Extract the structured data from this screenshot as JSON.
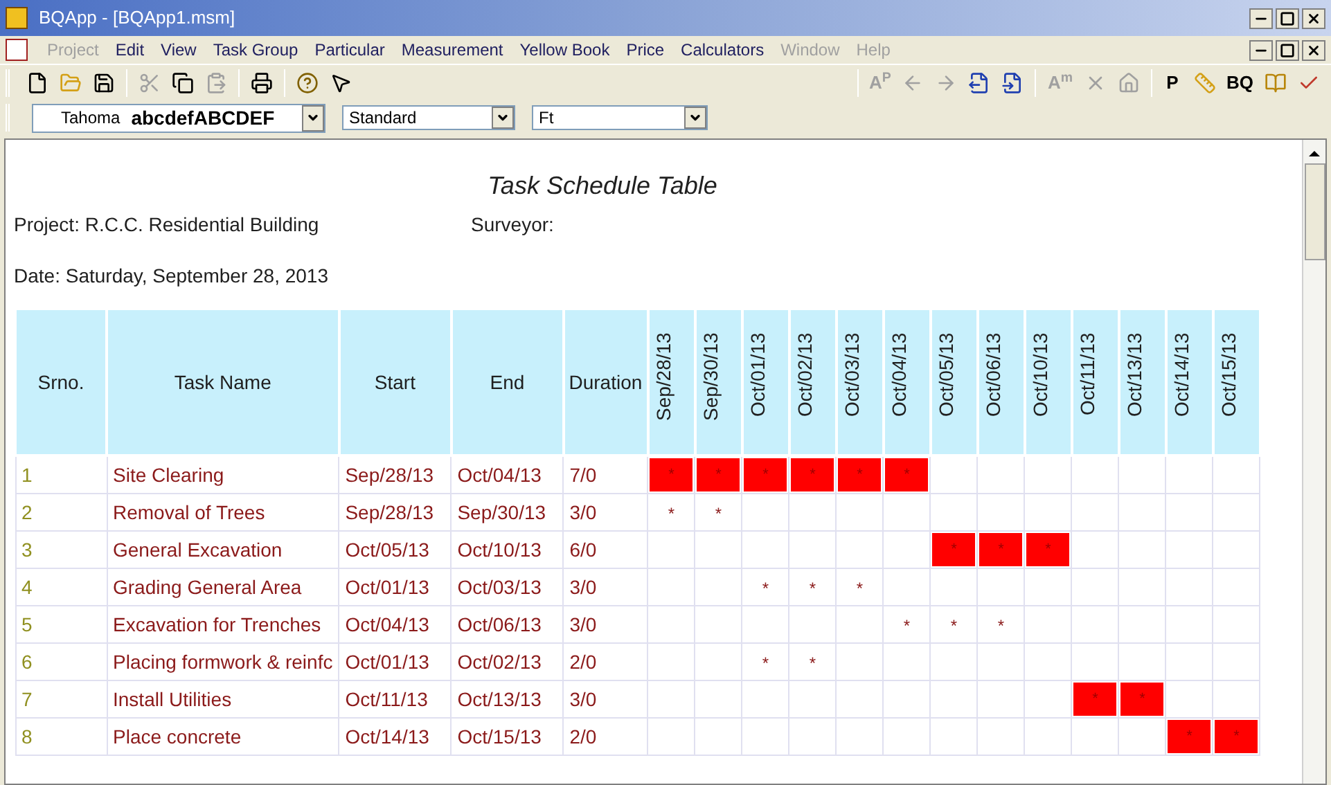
{
  "window": {
    "title": "BQApp - [BQApp1.msm]"
  },
  "menu": [
    {
      "label": "Project",
      "disabled": true
    },
    {
      "label": "Edit",
      "disabled": false
    },
    {
      "label": "View",
      "disabled": false
    },
    {
      "label": "Task Group",
      "disabled": false
    },
    {
      "label": "Particular",
      "disabled": false
    },
    {
      "label": "Measurement",
      "disabled": false
    },
    {
      "label": "Yellow Book",
      "disabled": false
    },
    {
      "label": "Price",
      "disabled": false
    },
    {
      "label": "Calculators",
      "disabled": false
    },
    {
      "label": "Window",
      "disabled": true
    },
    {
      "label": "Help",
      "disabled": true
    }
  ],
  "toolbar_left": [
    {
      "kind": "new",
      "disabled": false
    },
    {
      "kind": "open",
      "disabled": false
    },
    {
      "kind": "save",
      "disabled": false
    },
    {
      "kind": "sep"
    },
    {
      "kind": "cut",
      "disabled": true
    },
    {
      "kind": "copy",
      "disabled": false
    },
    {
      "kind": "paste",
      "disabled": true
    },
    {
      "kind": "sep"
    },
    {
      "kind": "print",
      "disabled": false
    },
    {
      "kind": "sep"
    },
    {
      "kind": "help",
      "disabled": false
    },
    {
      "kind": "whatsthis",
      "disabled": false
    }
  ],
  "toolbar_right": [
    {
      "kind": "sep"
    },
    {
      "kind": "text",
      "label": "A$^{P}$",
      "disabled": true
    },
    {
      "kind": "left",
      "disabled": true
    },
    {
      "kind": "right",
      "disabled": true
    },
    {
      "kind": "export",
      "disabled": false
    },
    {
      "kind": "import",
      "disabled": false
    },
    {
      "kind": "sep"
    },
    {
      "kind": "text",
      "label": "A$^{m}$",
      "disabled": true
    },
    {
      "kind": "cross",
      "disabled": true
    },
    {
      "kind": "house",
      "disabled": true
    },
    {
      "kind": "sep"
    },
    {
      "kind": "text",
      "label": "P",
      "disabled": false
    },
    {
      "kind": "ruler",
      "disabled": false
    },
    {
      "kind": "text",
      "label": "BQ",
      "disabled": false
    },
    {
      "kind": "book",
      "disabled": false
    },
    {
      "kind": "check",
      "disabled": false
    }
  ],
  "format_bar": {
    "font_name": "Tahoma",
    "font_sample": "abcdefABCDEF",
    "style": "Standard",
    "unit": "Ft"
  },
  "report": {
    "title": "Task Schedule Table",
    "project": "Project: R.C.C. Residential Building",
    "surveyor": "Surveyor:",
    "date": "Date: Saturday, September 28, 2013"
  },
  "table": {
    "columns": [
      "Srno.",
      "Task Name",
      "Start",
      "End",
      "Duration"
    ],
    "days": [
      "Sep/28/13",
      "Sep/30/13",
      "Oct/01/13",
      "Oct/02/13",
      "Oct/03/13",
      "Oct/04/13",
      "Oct/05/13",
      "Oct/06/13",
      "Oct/10/13",
      "Oct/11/13",
      "Oct/13/13",
      "Oct/14/13",
      "Oct/15/13"
    ],
    "rows": [
      {
        "srno": "1",
        "task": "Site Clearing",
        "start": "Sep/28/13",
        "end": "Oct/04/13",
        "duration": "7/0",
        "cells": [
          {
            "kind": "bar",
            "text": "*"
          },
          {
            "kind": "bar",
            "text": "*"
          },
          {
            "kind": "bar",
            "text": "*"
          },
          {
            "kind": "bar",
            "text": "*"
          },
          {
            "kind": "bar",
            "text": "*"
          },
          {
            "kind": "bar",
            "text": "*"
          },
          {
            "kind": "empty"
          },
          {
            "kind": "empty"
          },
          {
            "kind": "empty"
          },
          {
            "kind": "empty"
          },
          {
            "kind": "empty"
          },
          {
            "kind": "empty"
          },
          {
            "kind": "empty"
          }
        ]
      },
      {
        "srno": "2",
        "task": "Removal of Trees",
        "start": "Sep/28/13",
        "end": "Sep/30/13",
        "duration": "3/0",
        "cells": [
          {
            "kind": "mark",
            "text": "*"
          },
          {
            "kind": "mark",
            "text": "*"
          },
          {
            "kind": "empty"
          },
          {
            "kind": "empty"
          },
          {
            "kind": "empty"
          },
          {
            "kind": "empty"
          },
          {
            "kind": "empty"
          },
          {
            "kind": "empty"
          },
          {
            "kind": "empty"
          },
          {
            "kind": "empty"
          },
          {
            "kind": "empty"
          },
          {
            "kind": "empty"
          },
          {
            "kind": "empty"
          }
        ]
      },
      {
        "srno": "3",
        "task": "General Excavation",
        "start": "Oct/05/13",
        "end": "Oct/10/13",
        "duration": "6/0",
        "cells": [
          {
            "kind": "empty"
          },
          {
            "kind": "empty"
          },
          {
            "kind": "empty"
          },
          {
            "kind": "empty"
          },
          {
            "kind": "empty"
          },
          {
            "kind": "empty"
          },
          {
            "kind": "bar",
            "text": "*"
          },
          {
            "kind": "bar",
            "text": "*"
          },
          {
            "kind": "bar",
            "text": "*"
          },
          {
            "kind": "empty"
          },
          {
            "kind": "empty"
          },
          {
            "kind": "empty"
          },
          {
            "kind": "empty"
          }
        ]
      },
      {
        "srno": "4",
        "task": "Grading General Area",
        "start": "Oct/01/13",
        "end": "Oct/03/13",
        "duration": "3/0",
        "cells": [
          {
            "kind": "empty"
          },
          {
            "kind": "empty"
          },
          {
            "kind": "mark",
            "text": "*"
          },
          {
            "kind": "mark",
            "text": "*"
          },
          {
            "kind": "mark",
            "text": "*"
          },
          {
            "kind": "empty"
          },
          {
            "kind": "empty"
          },
          {
            "kind": "empty"
          },
          {
            "kind": "empty"
          },
          {
            "kind": "empty"
          },
          {
            "kind": "empty"
          },
          {
            "kind": "empty"
          },
          {
            "kind": "empty"
          }
        ]
      },
      {
        "srno": "5",
        "task": "Excavation for Trenches",
        "start": "Oct/04/13",
        "end": "Oct/06/13",
        "duration": "3/0",
        "cells": [
          {
            "kind": "empty"
          },
          {
            "kind": "empty"
          },
          {
            "kind": "empty"
          },
          {
            "kind": "empty"
          },
          {
            "kind": "empty"
          },
          {
            "kind": "mark",
            "text": "*"
          },
          {
            "kind": "mark",
            "text": "*"
          },
          {
            "kind": "mark",
            "text": "*"
          },
          {
            "kind": "empty"
          },
          {
            "kind": "empty"
          },
          {
            "kind": "empty"
          },
          {
            "kind": "empty"
          },
          {
            "kind": "empty"
          }
        ]
      },
      {
        "srno": "6",
        "task": "Placing formwork & reinfc",
        "start": "Oct/01/13",
        "end": "Oct/02/13",
        "duration": "2/0",
        "cells": [
          {
            "kind": "empty"
          },
          {
            "kind": "empty"
          },
          {
            "kind": "mark",
            "text": "*"
          },
          {
            "kind": "mark",
            "text": "*"
          },
          {
            "kind": "empty"
          },
          {
            "kind": "empty"
          },
          {
            "kind": "empty"
          },
          {
            "kind": "empty"
          },
          {
            "kind": "empty"
          },
          {
            "kind": "empty"
          },
          {
            "kind": "empty"
          },
          {
            "kind": "empty"
          },
          {
            "kind": "empty"
          }
        ]
      },
      {
        "srno": "7",
        "task": "Install Utilities",
        "start": "Oct/11/13",
        "end": "Oct/13/13",
        "duration": "3/0",
        "cells": [
          {
            "kind": "empty"
          },
          {
            "kind": "empty"
          },
          {
            "kind": "empty"
          },
          {
            "kind": "empty"
          },
          {
            "kind": "empty"
          },
          {
            "kind": "empty"
          },
          {
            "kind": "empty"
          },
          {
            "kind": "empty"
          },
          {
            "kind": "empty"
          },
          {
            "kind": "bar",
            "text": "*"
          },
          {
            "kind": "bar",
            "text": "*"
          },
          {
            "kind": "empty"
          },
          {
            "kind": "empty"
          }
        ]
      },
      {
        "srno": "8",
        "task": "Place concrete",
        "start": "Oct/14/13",
        "end": "Oct/15/13",
        "duration": "2/0",
        "cells": [
          {
            "kind": "empty"
          },
          {
            "kind": "empty"
          },
          {
            "kind": "empty"
          },
          {
            "kind": "empty"
          },
          {
            "kind": "empty"
          },
          {
            "kind": "empty"
          },
          {
            "kind": "empty"
          },
          {
            "kind": "empty"
          },
          {
            "kind": "empty"
          },
          {
            "kind": "empty"
          },
          {
            "kind": "empty"
          },
          {
            "kind": "bar",
            "text": "*"
          },
          {
            "kind": "bar",
            "text": "*"
          }
        ]
      }
    ]
  }
}
